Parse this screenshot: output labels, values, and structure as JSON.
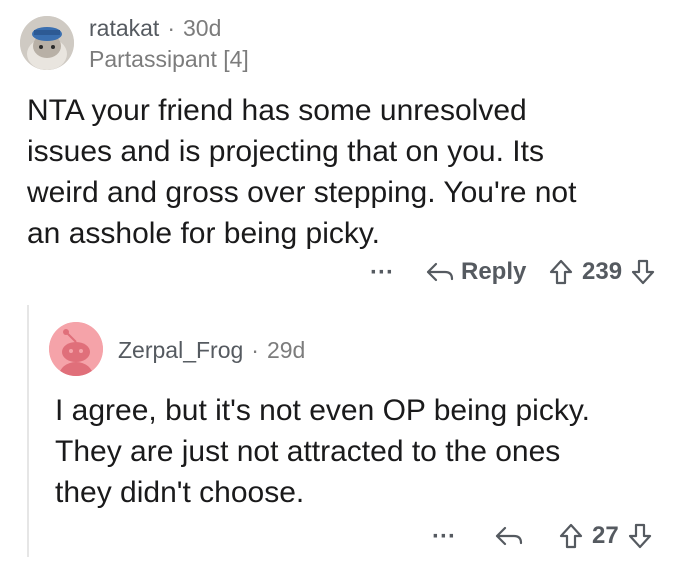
{
  "comments": [
    {
      "username": "ratakat",
      "separator": "·",
      "age": "30d",
      "flair": "Partassipant [4]",
      "body": [
        "NTA your friend has some unresolved",
        "issues and is projecting that on you. Its",
        "weird and gross over stepping. You're not",
        "an asshole for being picky."
      ],
      "actions": {
        "more": "···",
        "reply": "Reply",
        "score": "239"
      }
    },
    {
      "username": "Zerpal_Frog",
      "separator": "·",
      "age": "29d",
      "body": [
        "I agree, but it's not even OP being picky.",
        "They are just not attracted to the ones",
        "they didn't choose."
      ],
      "actions": {
        "more": "···",
        "score": "27"
      }
    }
  ]
}
